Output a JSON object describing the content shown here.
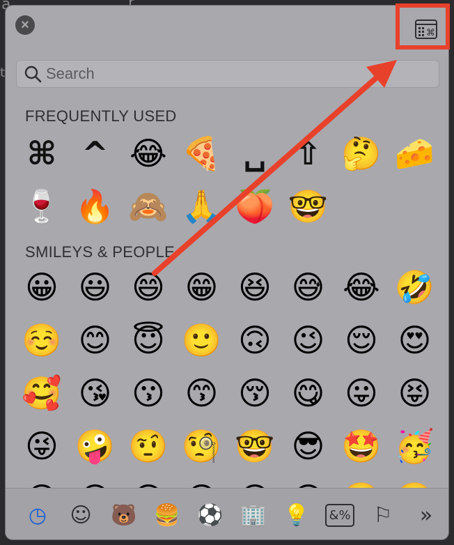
{
  "background_text": {
    "top_left": "a",
    "top_mid": "r",
    "side": "t"
  },
  "header": {
    "close_icon": "close-icon",
    "viewer_icon": "character-viewer-icon"
  },
  "search": {
    "placeholder": "Search",
    "value": ""
  },
  "sections": {
    "frequently_used": {
      "title": "FREQUENTLY USED",
      "items": [
        "⌘",
        "^",
        "😂",
        "🍕",
        "␣",
        "⇧",
        "🤔",
        "🧀",
        "🍷",
        "🔥",
        "🙈",
        "🙏",
        "🍑",
        "🤓"
      ]
    },
    "smileys": {
      "title": "SMILEYS & PEOPLE",
      "items": [
        "😀",
        "😃",
        "😄",
        "😁",
        "😆",
        "😅",
        "😂",
        "🤣",
        "☺️",
        "😊",
        "😇",
        "🙂",
        "🙃",
        "😉",
        "😌",
        "😍",
        "🥰",
        "😘",
        "😗",
        "😙",
        "😚",
        "😋",
        "😛",
        "😝",
        "😜",
        "🤪",
        "🤨",
        "🧐",
        "🤓",
        "😎",
        "🤩",
        "🥳",
        "😏",
        "😒",
        "😞",
        "😔",
        "😟",
        "😕",
        "🙁",
        "☹️"
      ]
    }
  },
  "categories": [
    {
      "name": "recent-icon",
      "glyph": "◷",
      "selected": true
    },
    {
      "name": "smiley-icon",
      "glyph": "☺",
      "selected": false
    },
    {
      "name": "animal-icon",
      "glyph": "🐻",
      "selected": false
    },
    {
      "name": "food-icon",
      "glyph": "🍔",
      "selected": false
    },
    {
      "name": "ball-icon",
      "glyph": "⚽",
      "selected": false
    },
    {
      "name": "building-icon",
      "glyph": "🏢",
      "selected": false
    },
    {
      "name": "lightbulb-icon",
      "glyph": "💡",
      "selected": false
    },
    {
      "name": "symbols-icon",
      "glyph": "&%",
      "selected": false
    },
    {
      "name": "flag-icon",
      "glyph": "⚐",
      "selected": false
    },
    {
      "name": "more-icon",
      "glyph": "»",
      "selected": false
    }
  ],
  "colors": {
    "accent": "#1f5fd1",
    "annotation": "#e8412b",
    "panel": "#a9a8ad"
  }
}
